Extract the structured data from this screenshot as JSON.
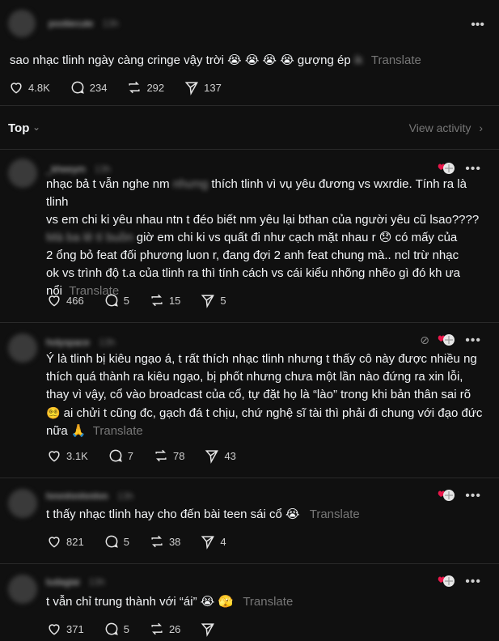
{
  "post": {
    "username": "pootiecute",
    "time": "13h",
    "text": "sao nhạc tlinh ngày càng cringe vậy trời 😭 😭 😭 😭 gượng ép",
    "text_blurred_tail": "ik",
    "translate": "Translate",
    "likes": "4.8K",
    "comments": "234",
    "reposts": "292",
    "shares": "137"
  },
  "sort": {
    "label": "Top",
    "view_activity": "View activity"
  },
  "replies": [
    {
      "username": "_kheeym",
      "time": "13h",
      "line1": "nhạc bả t vẫn nghe nm",
      "line1_blur": "nhưng",
      "line1_b": "thích tlinh vì vụ yêu đương vs wxrdie. Tính ra là tlinh",
      "line2": "vs em chi ki yêu nhau ntn t đéo biết nm yêu lại bthan của người yêu cũ lsao????",
      "line3_blur": "Mà ba lẻ tí buồn",
      "line3": "giờ em chi ki vs quất đi như cạch mặt nhau r 😞 có mấy của",
      "line4": "2 ổng bỏ feat đối phương luon r, đang đợi 2 anh feat chung mà.. ncl trừ nhạc",
      "line5": "ok vs trình độ t.a của tlinh ra thì tính cách vs cái kiểu nhõng nhẽo gì đó kh ưa",
      "line6": "nổi",
      "translate": "Translate",
      "likes": "466",
      "comments": "5",
      "reposts": "15",
      "shares": "5"
    },
    {
      "username": "holyspace",
      "time": "13h",
      "line1": "Ý là tlinh bị kiêu ngạo á, t rất thích nhạc tlinh nhưng t thấy cô này được nhiều ng",
      "line2": "thích quá thành ra kiêu ngạo, bị phốt nhưng chưa một lần nào đứng ra xin lỗi,",
      "line3": "thay vì vậy, cổ vào broadcast của cổ, tự đặt họ là “lào” trong khi bản thân sai rõ",
      "line4": "ai chửi t cũng đc, gạch đá t chịu, chứ nghệ sĩ tài thì phải đi chung với đạo đức",
      "line5": "nữa 🙏",
      "line4_emoji": "😵‍💫",
      "translate": "Translate",
      "likes": "3.1K",
      "comments": "7",
      "reposts": "78",
      "shares": "43"
    },
    {
      "username": "hmmhmhmhm",
      "time": "13h",
      "line1": "t thấy nhạc tlinh hay cho đến bài teen sái cổ 😭",
      "translate": "Translate",
      "likes": "821",
      "comments": "5",
      "reposts": "38",
      "shares": "4"
    },
    {
      "username": "ludagiai",
      "time": "13h",
      "line1": "t vẫn chỉ trung thành với “ái” 😭 🫣",
      "translate": "Translate",
      "likes": "371",
      "comments": "5",
      "reposts": "26",
      "shares": ""
    }
  ],
  "icons": {
    "like": "heart-icon",
    "comment": "comment-icon",
    "repost": "repost-icon",
    "share": "send-icon",
    "more": "more-icon"
  },
  "colors": {
    "background": "#101010",
    "text": "#f3f5f7",
    "muted": "#777777",
    "divider": "#2a2a2a"
  }
}
